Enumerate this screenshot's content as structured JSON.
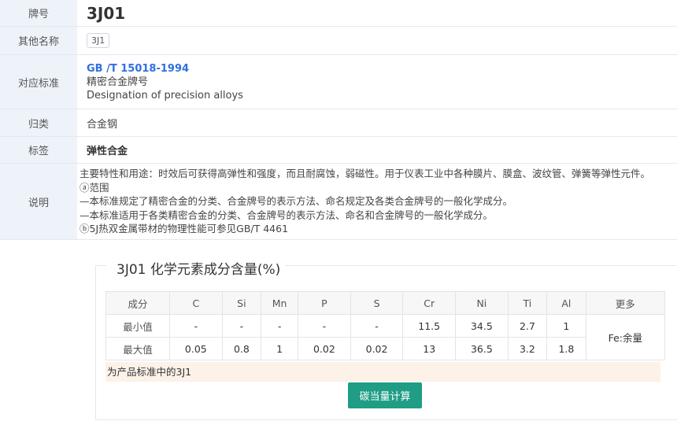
{
  "info": {
    "title_label": "牌号",
    "title_value": "3J01",
    "other_label": "其他名称",
    "other_value": "3J1",
    "standard_label": "对应标准",
    "standard_code": "GB /T 15018-1994",
    "standard_name_cn": "精密合金牌号",
    "standard_name_en": "Designation of precision alloys",
    "category_label": "归类",
    "category_value": "合金钢",
    "tag_label": "标签",
    "tag_value": "弹性合金",
    "desc_label": "说明",
    "desc_lines": [
      "主要特性和用途：时效后可获得高弹性和强度，而且耐腐蚀，弱磁性。用于仪表工业中各种膜片、膜盒、波纹管、弹簧等弹性元件。",
      "ⓐ范围",
      "—本标准规定了精密合金的分类、合金牌号的表示方法、命名规定及各类合金牌号的一般化学成分。",
      "—本标准适用于各类精密合金的分类、合金牌号的表示方法、命名和合金牌号的一般化学成分。",
      "ⓑ5J热双金属带材的物理性能可参见GB/T 4461"
    ]
  },
  "composition": {
    "legend": "3J01 化学元素成分含量(%)",
    "headers": [
      "成分",
      "C",
      "Si",
      "Mn",
      "P",
      "S",
      "Cr",
      "Ni",
      "Ti",
      "Al",
      "更多"
    ],
    "min_row": [
      "最小值",
      "-",
      "-",
      "-",
      "-",
      "-",
      "11.5",
      "34.5",
      "2.7",
      "1"
    ],
    "max_row": [
      "最大值",
      "0.05",
      "0.8",
      "1",
      "0.02",
      "0.02",
      "13",
      "36.5",
      "3.2",
      "1.8"
    ],
    "more": "Fe:余量",
    "note": "为产品标准中的3J1",
    "button": "碳当量计算"
  }
}
